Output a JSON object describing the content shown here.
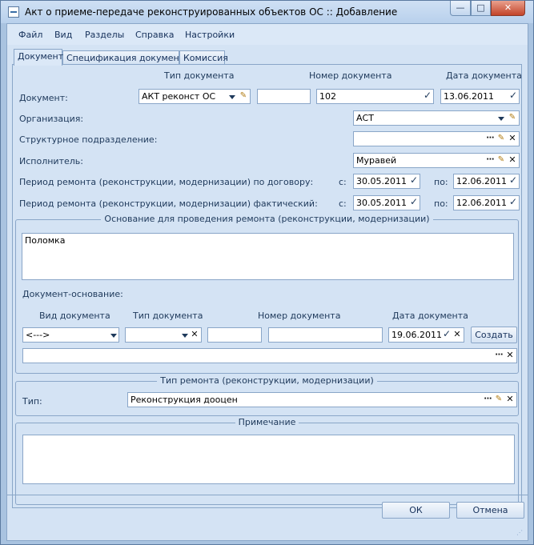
{
  "window": {
    "title": "Акт о приеме-передаче реконструированных объектов ОС :: Добавление",
    "min_glyph": "—",
    "max_glyph": "□",
    "close_glyph": "✕"
  },
  "menu": {
    "items": [
      "Файл",
      "Вид",
      "Разделы",
      "Справка",
      "Настройки"
    ]
  },
  "tabs": [
    {
      "label": "Документ",
      "active": true
    },
    {
      "label": "Спецификация документа",
      "active": false
    },
    {
      "label": "Комиссия",
      "active": false
    }
  ],
  "document": {
    "header_type": "Тип документа",
    "header_number": "Номер документа",
    "header_date": "Дата документа",
    "label": "Документ:",
    "type_value": "АКТ реконст ОС",
    "prefix_value": "",
    "number_value": "102",
    "date_value": "13.06.2011"
  },
  "organization": {
    "label": "Организация:",
    "value": "АСТ"
  },
  "department": {
    "label": "Структурное подразделение:",
    "value": ""
  },
  "executor": {
    "label": "Исполнитель:",
    "value": "Муравей"
  },
  "period_contract": {
    "label": "Период ремонта (реконструкции, модернизации) по договору:",
    "from_label": "с:",
    "from_value": "30.05.2011",
    "to_label": "по:",
    "to_value": "12.06.2011"
  },
  "period_actual": {
    "label": "Период ремонта (реконструкции, модернизации) фактический:",
    "from_label": "с:",
    "from_value": "30.05.2011",
    "to_label": "по:",
    "to_value": "12.06.2011"
  },
  "basis": {
    "title": "Основание для проведения ремонта (реконструкции, модернизации)",
    "text": "Поломка",
    "base_doc_label": "Документ-основание:",
    "col_kind": "Вид документа",
    "col_type": "Тип документа",
    "col_number": "Номер документа",
    "col_date": "Дата документа",
    "kind_value": "<--->",
    "type_value": "",
    "prefix_value": "",
    "number_value": "",
    "date_value": "19.06.2011",
    "create_button": "Создать",
    "ref_value": ""
  },
  "repair_type": {
    "title": "Тип ремонта (реконструкции, модернизации)",
    "label": "Тип:",
    "value": "Реконструкция дооцен"
  },
  "note": {
    "title": "Примечание",
    "text": ""
  },
  "buttons": {
    "ok": "ОК",
    "cancel": "Отмена"
  },
  "icons": {
    "dots": "⋯",
    "pencil": "✎",
    "clear": "✕"
  }
}
